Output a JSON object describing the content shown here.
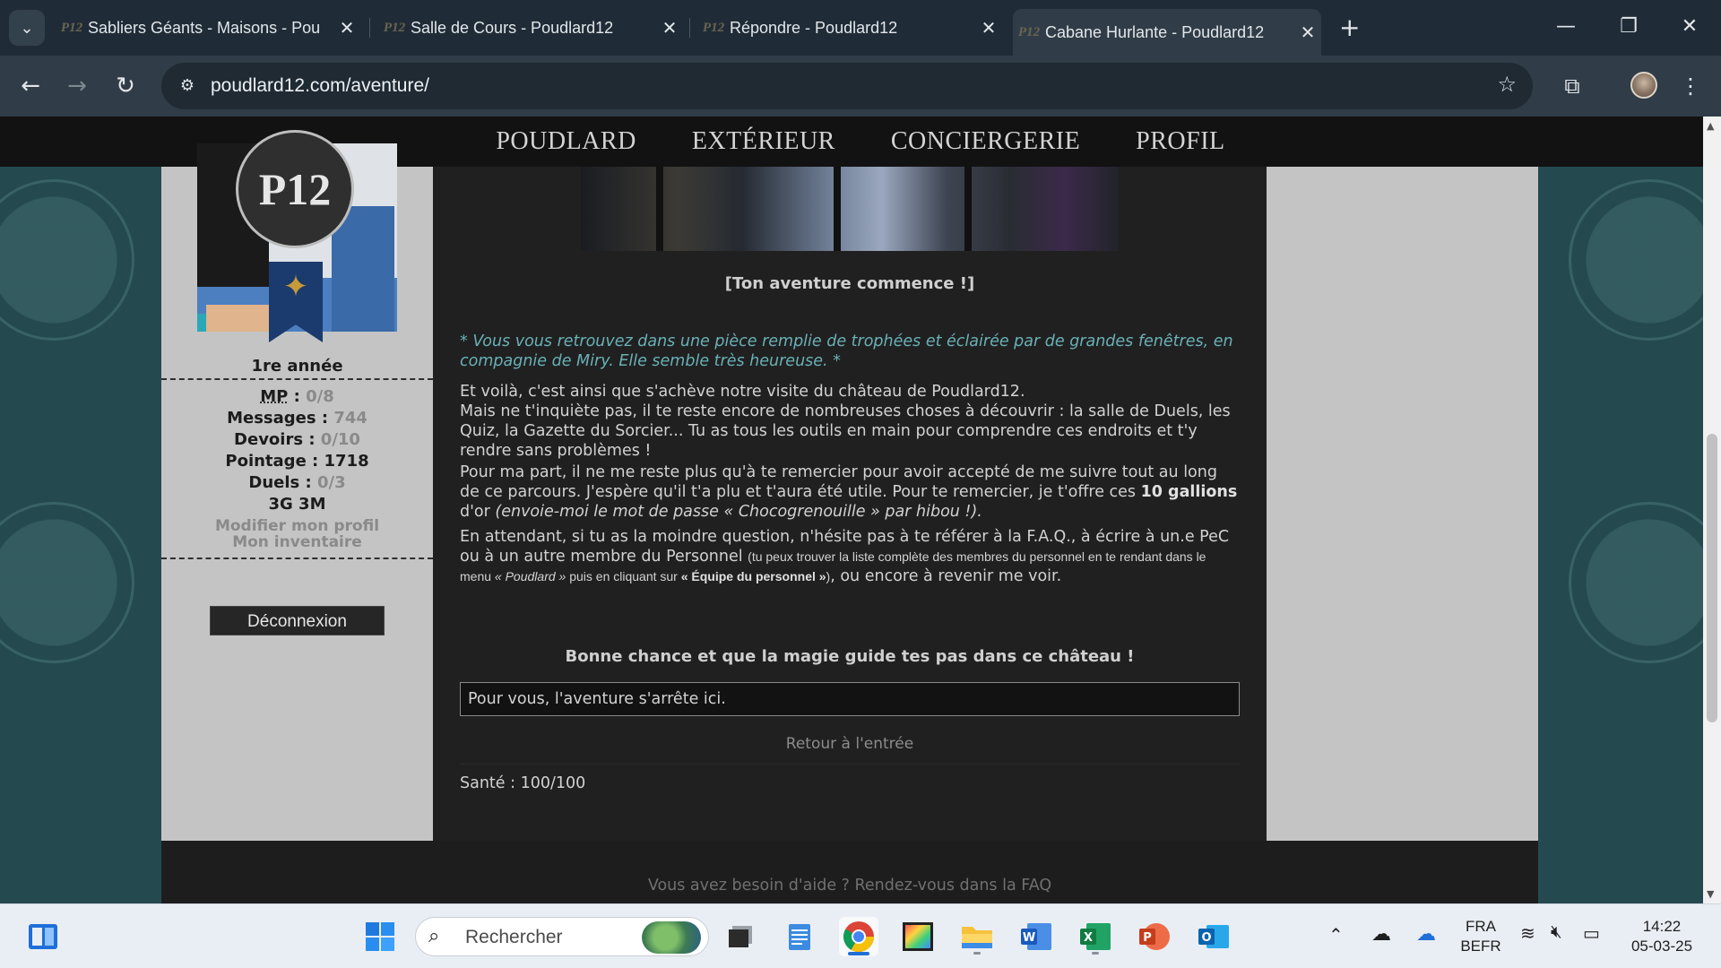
{
  "browser": {
    "tabs": [
      {
        "favicon": "P12",
        "title": "Sabliers Géants - Maisons - Pou",
        "active": false
      },
      {
        "favicon": "P12",
        "title": "Salle de Cours - Poudlard12",
        "active": false
      },
      {
        "favicon": "P12",
        "title": "Répondre - Poudlard12",
        "active": false
      },
      {
        "favicon": "P12",
        "title": "Cabane Hurlante - Poudlard12",
        "active": true
      }
    ],
    "url": "poudlard12.com/aventure/",
    "icons": {
      "tab_list": "chevron-down-icon",
      "new_tab": "plus-icon",
      "back": "arrow-left-icon",
      "forward": "arrow-right-icon",
      "reload": "reload-icon",
      "site_info": "tune-icon",
      "bookmark": "star-icon",
      "extensions": "puzzle-icon",
      "menu": "kebab-menu-icon"
    }
  },
  "site_nav": [
    "POUDLARD",
    "EXTÉRIEUR",
    "CONCIERGERIE",
    "PROFIL"
  ],
  "sidebar": {
    "logo_text": "P12",
    "year": "1re année",
    "stats": [
      {
        "label": "MP",
        "sep": " : ",
        "value": "0/8"
      },
      {
        "label": "Messages",
        "sep": " : ",
        "value": "744"
      },
      {
        "label": "Devoirs",
        "sep": " : ",
        "value": "0/10"
      },
      {
        "label": "Pointage : 1718",
        "sep": "",
        "value": ""
      },
      {
        "label": "Duels",
        "sep": " : ",
        "value": "0/3"
      },
      {
        "label": "3G 3M",
        "sep": "",
        "value": ""
      }
    ],
    "links": [
      "Modifier mon profil",
      "Mon inventaire"
    ],
    "logout": "Déconnexion"
  },
  "main": {
    "title": "[Ton aventure commence !]",
    "narration": "* Vous vous retrouvez dans une pièce remplie de trophées et éclairée par de grandes fenêtres, en compagnie de Miry. Elle semble très heureuse. *",
    "p1": "Et voilà, c'est ainsi que s'achève notre visite du château de Poudlard12.",
    "p2": "Mais ne t'inquiète pas, il te reste encore de nombreuses choses à découvrir : la salle de Duels, les Quiz, la Gazette du Sorcier... Tu as tous les outils en main pour comprendre ces endroits et t'y rendre sans problèmes !",
    "p3_a": "Pour ma part, il ne me reste plus qu'à te remercier pour avoir accepté de me suivre tout au long de ce parcours. J'espère qu'il t'a plu et t'aura été utile. Pour te remercier, je t'offre ces ",
    "p3_b": "10 gallions",
    "p3_c": " d'or ",
    "p3_d": "(envoie-moi le mot de passe « Chocogrenouille » par hibou !).",
    "p4_a": "En attendant, si tu as la moindre question, n'hésite pas à te référer à la F.A.Q., à écrire à un.e PeC ou à un autre membre du Personnel ",
    "p4_small_a": "(tu peux trouver la liste complète des membres du personnel en te rendant dans le menu ",
    "p4_small_b": "« Poudlard »",
    "p4_small_c": " puis en cliquant sur ",
    "p4_small_d": "« Équipe du personnel »",
    "p4_small_e": ")",
    "p4_b": ", ou encore à revenir me voir.",
    "good_luck": "Bonne chance et que la magie guide tes pas dans ce château !",
    "end_box": "Pour vous, l'aventure s'arrête ici.",
    "back_link": "Retour à l'entrée",
    "health": "Santé : 100/100"
  },
  "footer": {
    "help": "Vous avez besoin d'aide ? Rendez-vous dans la FAQ"
  },
  "taskbar": {
    "search_placeholder": "Rechercher",
    "apps": [
      "widgets-icon",
      "windows-start-icon",
      "task-view-icon",
      "notepad-icon",
      "chrome-icon",
      "photos-icon",
      "file-explorer-icon",
      "word-icon",
      "excel-icon",
      "powerpoint-icon",
      "outlook-icon"
    ],
    "tray": {
      "lang_top": "FRA",
      "lang_bottom": "BEFR",
      "time": "14:22",
      "date": "05-03-25"
    }
  },
  "colors": {
    "page_bg": "#244a50",
    "content_bg": "#202020",
    "sidebar_bg": "#c4c4c4",
    "narration": "#6ab0b6",
    "nav_bg": "#121212"
  }
}
